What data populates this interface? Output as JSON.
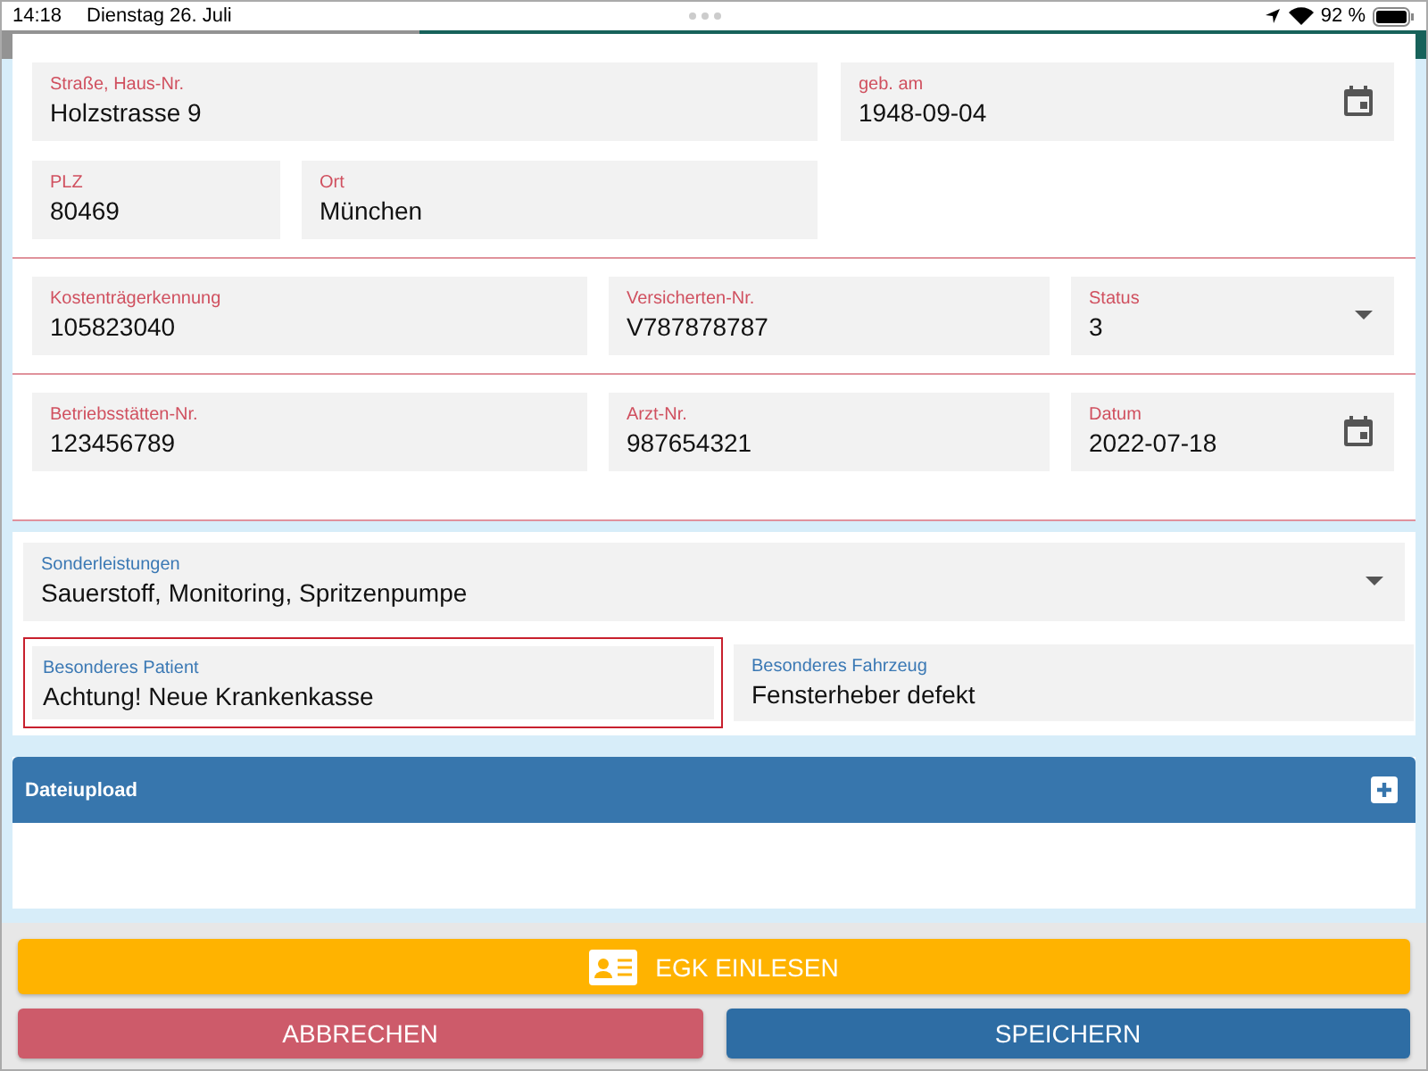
{
  "status_bar": {
    "time": "14:18",
    "date": "Dienstag 26. Juli",
    "battery": "92 %"
  },
  "patient_panel": {
    "rows": [
      {
        "fields": [
          {
            "label": "Straße, Haus-Nr.",
            "value": "Holzstrasse 9",
            "kind": "text",
            "error": true
          },
          {
            "label": "geb. am",
            "value": "1948-09-04",
            "kind": "date",
            "error": true
          }
        ]
      },
      {
        "fields": [
          {
            "label": "PLZ",
            "value": "80469",
            "kind": "text",
            "error": true
          },
          {
            "label": "Ort",
            "value": "München",
            "kind": "text",
            "error": true
          }
        ]
      },
      {
        "fields": [
          {
            "label": "Kostenträgerkennung",
            "value": "105823040",
            "kind": "text",
            "error": true
          },
          {
            "label": "Versicherten-Nr.",
            "value": "V787878787",
            "kind": "text",
            "error": true
          },
          {
            "label": "Status",
            "value": "3",
            "kind": "select",
            "error": true
          }
        ]
      },
      {
        "fields": [
          {
            "label": "Betriebsstätten-Nr.",
            "value": "123456789",
            "kind": "text",
            "error": true
          },
          {
            "label": "Arzt-Nr.",
            "value": "987654321",
            "kind": "text",
            "error": true
          },
          {
            "label": "Datum",
            "value": "2022-07-18",
            "kind": "date",
            "error": true
          }
        ]
      }
    ]
  },
  "extras_panel": {
    "rows": [
      {
        "fields": [
          {
            "label": "Sonderleistungen",
            "value": "Sauerstoff, Monitoring, Spritzenpumpe",
            "kind": "select",
            "error": false,
            "focused": false
          }
        ]
      },
      {
        "fields": [
          {
            "label": "Besonderes Patient",
            "value": "Achtung! Neue Krankenkasse",
            "kind": "text",
            "error": false,
            "focused": true
          },
          {
            "label": "Besonderes Fahrzeug",
            "value": "Fensterheber defekt",
            "kind": "text",
            "error": false,
            "focused": false
          }
        ]
      }
    ]
  },
  "upload": {
    "title": "Dateiupload"
  },
  "buttons": [
    {
      "label": "EGK EINLESEN",
      "kind": "card"
    },
    {
      "label": "ABBRECHEN",
      "kind": "cancel"
    },
    {
      "label": "SPEICHERN",
      "kind": "save"
    }
  ]
}
